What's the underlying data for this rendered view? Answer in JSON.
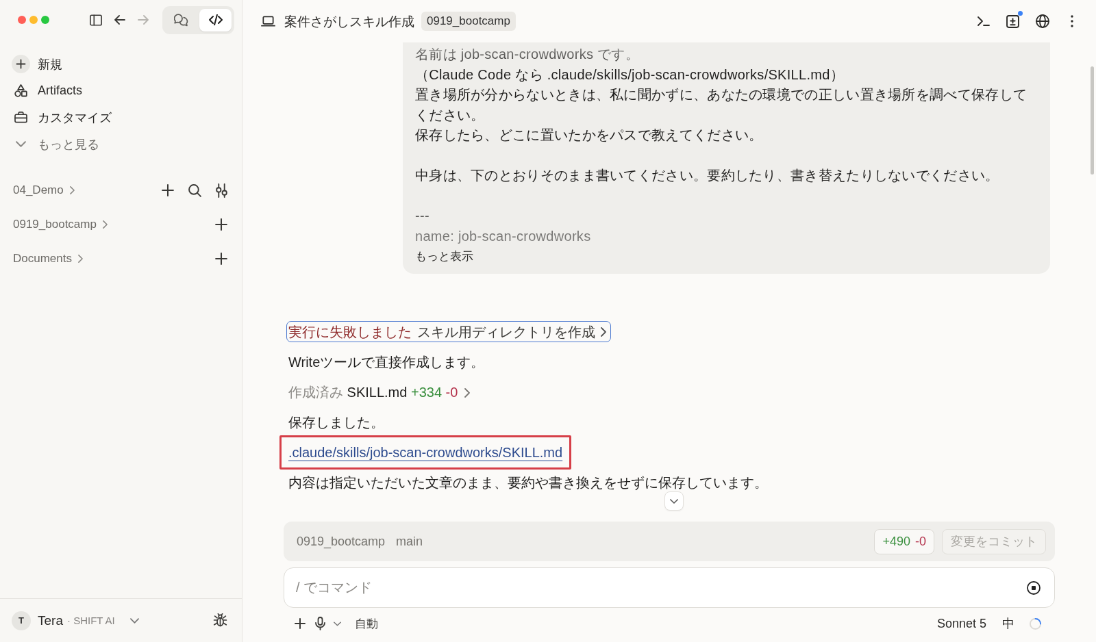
{
  "sidebar": {
    "nav_buttons": [
      {
        "kind": "back",
        "disabled": false
      },
      {
        "kind": "forward",
        "disabled": true
      }
    ],
    "mode_switch": [
      {
        "kind": "chat",
        "selected": false
      },
      {
        "kind": "code",
        "selected": true
      }
    ],
    "items": [
      {
        "kind": "new",
        "label": "新規"
      },
      {
        "kind": "artifacts",
        "label": "Artifacts"
      },
      {
        "kind": "customize",
        "label": "カスタマイズ"
      },
      {
        "kind": "more",
        "label": "もっと見る"
      }
    ],
    "projects": [
      {
        "name": "04_Demo",
        "tools": [
          {
            "kind": "add"
          },
          {
            "kind": "search"
          },
          {
            "kind": "filter"
          }
        ]
      },
      {
        "name": "0919_bootcamp",
        "tools": [
          {
            "kind": "add"
          }
        ]
      },
      {
        "name": "Documents",
        "tools": [
          {
            "kind": "add"
          }
        ]
      }
    ],
    "user": {
      "initial": "T",
      "name": "Tera",
      "org": "· SHIFT AI"
    }
  },
  "header": {
    "title": "案件さがしスキル作成",
    "badge": "0919_bootcamp",
    "notification": true
  },
  "prompt_bubble": {
    "collapsed": true,
    "paragraphs": [
      [
        "名前は job-scan-crowdworks です。",
        "（Claude Code なら .claude/skills/job-scan-crowdworks/SKILL.md）",
        "置き場所が分からないときは、私に聞かずに、あなたの環境での正しい置き場所を調べて保存してください。",
        "保存したら、どこに置いたかをパスで教えてください。"
      ],
      [
        "中身は、下のとおりそのまま書いてください。要約したり、書き替えたりしないでください。"
      ],
      [
        "---",
        "name: job-scan-crowdworks"
      ]
    ],
    "show_more": "もっと表示"
  },
  "messages": [
    {
      "kind": "tool",
      "status": "実行に失敗しました",
      "label": "スキル用ディレクトリを作成",
      "failed": true,
      "focused": true
    },
    {
      "kind": "text",
      "text": "Writeツールで直接作成します。"
    },
    {
      "kind": "file",
      "status": "作成済み",
      "file": "SKILL.md",
      "added": "+334",
      "removed": "-0"
    },
    {
      "kind": "text",
      "text": "保存しました。"
    },
    {
      "kind": "link",
      "text": ".claude/skills/job-scan-crowdworks/SKILL.md",
      "highlighted": true
    },
    {
      "kind": "text",
      "text": "内容は指定いただいた文章のまま、要約や書き換えをせずに保存しています。"
    }
  ],
  "git_bar": {
    "repo": "0919_bootcamp",
    "branch": "main",
    "added": "+490",
    "removed": "-0",
    "commit_button": {
      "label": "変更をコミット",
      "disabled": true
    }
  },
  "composer": {
    "placeholder": "/ でコマンド",
    "mode": "自動",
    "model": "Sonnet 5",
    "effort": "中"
  }
}
